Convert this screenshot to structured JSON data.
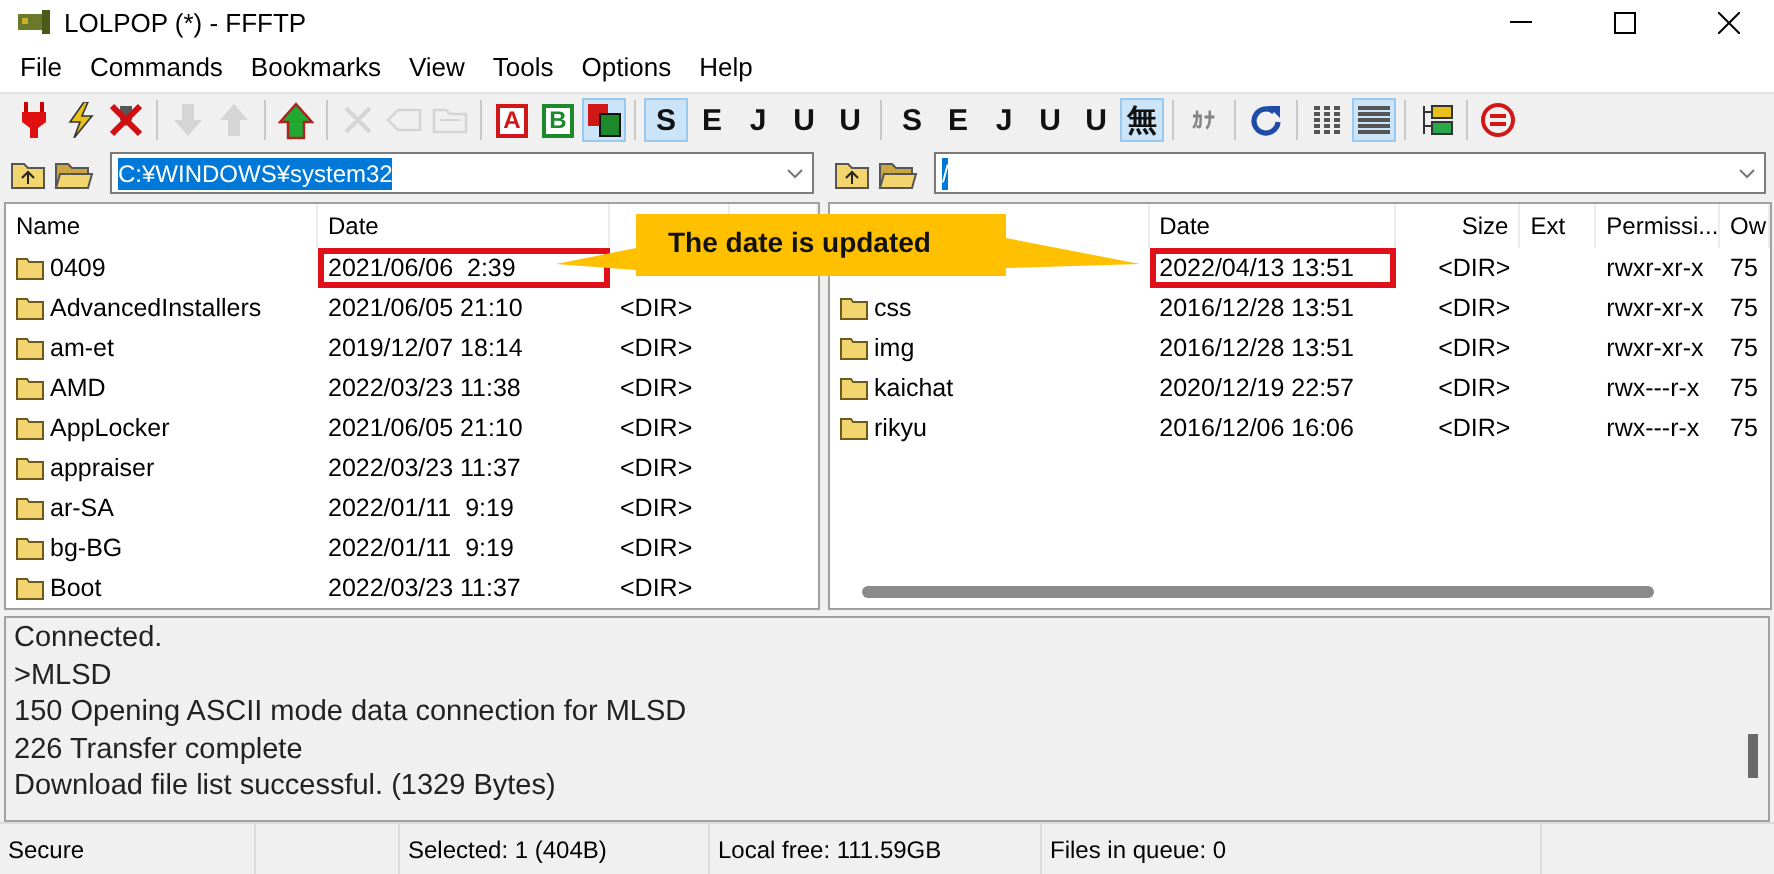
{
  "window": {
    "title": "LOLPOP (*) - FFFTP"
  },
  "menu": [
    "File",
    "Commands",
    "Bookmarks",
    "View",
    "Tools",
    "Options",
    "Help"
  ],
  "toolbar": [
    {
      "kind": "plug",
      "disabled": false,
      "selected": false
    },
    {
      "kind": "bolt",
      "disabled": false,
      "selected": false
    },
    {
      "kind": "unplug",
      "disabled": false,
      "selected": false
    },
    {
      "kind": "separator"
    },
    {
      "kind": "download",
      "disabled": true,
      "selected": false
    },
    {
      "kind": "upload",
      "disabled": true,
      "selected": false
    },
    {
      "kind": "separator"
    },
    {
      "kind": "mirror",
      "disabled": false,
      "selected": false
    },
    {
      "kind": "separator"
    },
    {
      "kind": "delete",
      "disabled": true,
      "selected": false
    },
    {
      "kind": "rename",
      "disabled": true,
      "selected": false
    },
    {
      "kind": "newfolder",
      "disabled": true,
      "selected": false
    },
    {
      "kind": "separator"
    },
    {
      "kind": "mode",
      "label": "A",
      "color": "#d01818",
      "disabled": false,
      "selected": false
    },
    {
      "kind": "mode",
      "label": "B",
      "color": "#1c8a2a",
      "disabled": false,
      "selected": false
    },
    {
      "kind": "automode",
      "disabled": false,
      "selected": true
    },
    {
      "kind": "separator"
    },
    {
      "kind": "code",
      "label": "S",
      "disabled": false,
      "selected": true
    },
    {
      "kind": "code",
      "label": "E",
      "disabled": false,
      "selected": false
    },
    {
      "kind": "code",
      "label": "J",
      "disabled": false,
      "selected": false
    },
    {
      "kind": "code",
      "label": "U",
      "disabled": false,
      "selected": false
    },
    {
      "kind": "code",
      "label": "U",
      "disabled": false,
      "selected": false
    },
    {
      "kind": "separator"
    },
    {
      "kind": "code",
      "label": "S",
      "disabled": false,
      "selected": false
    },
    {
      "kind": "code",
      "label": "E",
      "disabled": false,
      "selected": false
    },
    {
      "kind": "code",
      "label": "J",
      "disabled": false,
      "selected": false
    },
    {
      "kind": "code",
      "label": "U",
      "disabled": false,
      "selected": false
    },
    {
      "kind": "code",
      "label": "U",
      "disabled": false,
      "selected": false
    },
    {
      "kind": "code",
      "label": "無",
      "disabled": false,
      "selected": true
    },
    {
      "kind": "separator"
    },
    {
      "kind": "code",
      "label": "ｶﾅ",
      "disabled": true,
      "selected": false
    },
    {
      "kind": "separator"
    },
    {
      "kind": "refresh",
      "disabled": false,
      "selected": false
    },
    {
      "kind": "separator"
    },
    {
      "kind": "list",
      "disabled": false,
      "selected": false
    },
    {
      "kind": "details",
      "disabled": false,
      "selected": true
    },
    {
      "kind": "separator"
    },
    {
      "kind": "tree",
      "disabled": false,
      "selected": false
    },
    {
      "kind": "separator"
    },
    {
      "kind": "stop",
      "disabled": false,
      "selected": false
    }
  ],
  "local": {
    "path": "C:¥WINDOWS¥system32",
    "columns": [
      {
        "label": "Name"
      },
      {
        "label": "Date"
      }
    ],
    "rows": [
      {
        "name": "0409",
        "date": "2021/06/06  2:39",
        "highlighted": true
      },
      {
        "name": "AdvancedInstallers",
        "date": "2021/06/05 21:10",
        "size": "<DIR>",
        "highlighted": false
      },
      {
        "name": "am-et",
        "date": "2019/12/07 18:14",
        "size": "<DIR>",
        "highlighted": false
      },
      {
        "name": "AMD",
        "date": "2022/03/23 11:38",
        "size": "<DIR>",
        "highlighted": false
      },
      {
        "name": "AppLocker",
        "date": "2021/06/05 21:10",
        "size": "<DIR>",
        "highlighted": false
      },
      {
        "name": "appraiser",
        "date": "2022/03/23 11:37",
        "size": "<DIR>",
        "highlighted": false
      },
      {
        "name": "ar-SA",
        "date": "2022/01/11  9:19",
        "size": "<DIR>",
        "highlighted": false
      },
      {
        "name": "bg-BG",
        "date": "2022/01/11  9:19",
        "size": "<DIR>",
        "highlighted": false
      },
      {
        "name": "Boot",
        "date": "2022/03/23 11:37",
        "size": "<DIR>",
        "highlighted": false
      }
    ]
  },
  "remote": {
    "path": "/",
    "columns": [
      {},
      {
        "label": "Date"
      },
      {
        "label": "Size"
      },
      {
        "label": "Ext"
      },
      {
        "label": "Permissi..."
      },
      {
        "label": "Ow"
      }
    ],
    "rows": [
      {
        "date": "2022/04/13 13:51",
        "size": "<DIR>",
        "permissions": "rwxr-xr-x",
        "owner": "75",
        "highlighted": true
      },
      {
        "name": "css",
        "date": "2016/12/28 13:51",
        "size": "<DIR>",
        "permissions": "rwxr-xr-x",
        "owner": "75",
        "highlighted": false
      },
      {
        "name": "img",
        "date": "2016/12/28 13:51",
        "size": "<DIR>",
        "permissions": "rwxr-xr-x",
        "owner": "75",
        "highlighted": false
      },
      {
        "name": "kaichat",
        "date": "2020/12/19 22:57",
        "size": "<DIR>",
        "permissions": "rwx---r-x",
        "owner": "75",
        "highlighted": false
      },
      {
        "name": "rikyu",
        "date": "2016/12/06 16:06",
        "size": "<DIR>",
        "permissions": "rwx---r-x",
        "owner": "75",
        "highlighted": false
      }
    ]
  },
  "callout": {
    "text": "The date is updated"
  },
  "log": [
    "Connected.",
    ">MLSD",
    "150 Opening ASCII mode data connection for MLSD",
    "226 Transfer complete",
    "Download file list successful. (1329 Bytes)"
  ],
  "status_bar": [
    {
      "kind": "text",
      "text": "Secure"
    },
    {
      "kind": "spacer"
    },
    {
      "kind": "text",
      "text": "Selected: 1 (404B)"
    },
    {
      "kind": "text",
      "text": "Local free: 111.59GB"
    },
    {
      "kind": "text",
      "text": "Files in queue: 0"
    }
  ]
}
